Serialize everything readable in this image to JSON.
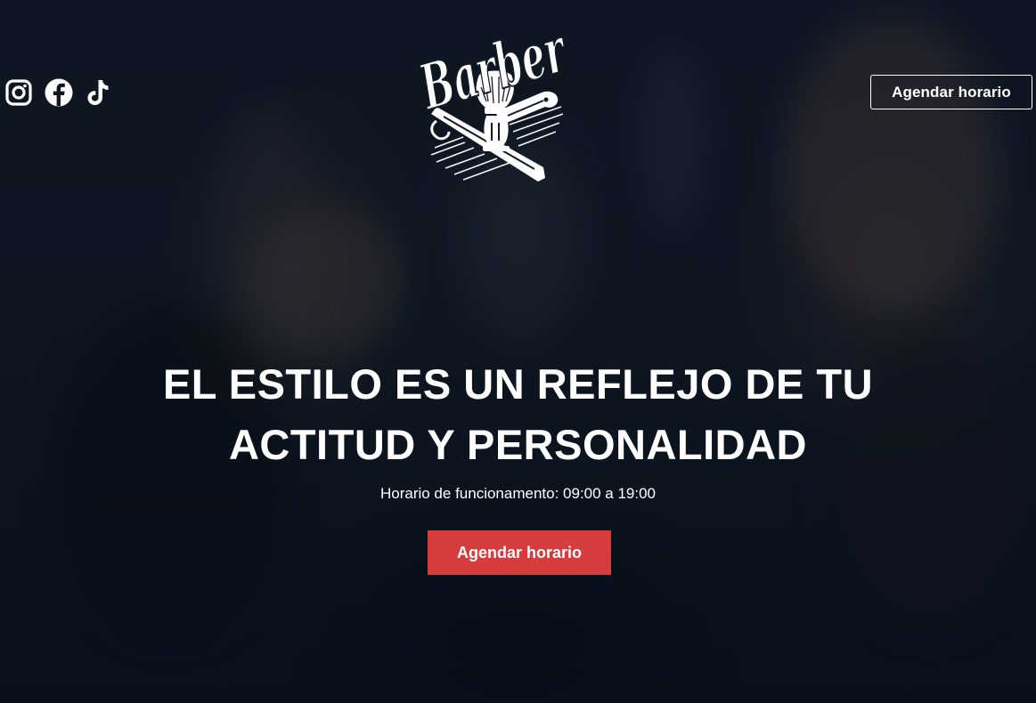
{
  "brand": {
    "logo_text": "Barber"
  },
  "social": {
    "icons": [
      "instagram-icon",
      "facebook-icon",
      "tiktok-icon"
    ]
  },
  "header": {
    "cta_label": "Agendar horario"
  },
  "hero": {
    "headline_line1": "EL ESTILO ES UN REFLEJO DE TU",
    "headline_line2": "ACTITUD Y PERSONALIDAD",
    "hours_text": "Horario de funcionamento: 09:00 a 19:00",
    "cta_label": "Agendar horario"
  },
  "colors": {
    "accent": "#d63c3c",
    "background": "#0b1421",
    "text": "#ffffff"
  }
}
